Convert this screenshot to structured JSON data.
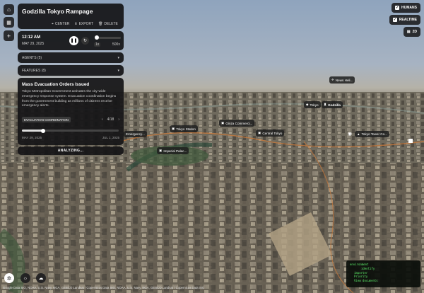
{
  "title": "Godzilla Tokyo Rampage",
  "toolbar": {
    "center_label": "CENTER",
    "export_label": "EXPORT",
    "delete_label": "DELETE"
  },
  "time": {
    "clock": "12:12 AM",
    "date": "MAY 29, 2025",
    "speed_min": "1x",
    "speed_max": "500x"
  },
  "sections": {
    "agents_label": "AGENTS (5)",
    "features_label": "FEATURES (8)"
  },
  "event": {
    "title": "Mass Evacuation Orders Issued",
    "body": "Tokyo Metropolitan Government activates the city-wide emergency response system. Evacuation coordination begins from the government building as millions of citizens receive emergency alerts.",
    "tag": "EVACUATION COORDINATION",
    "counter": "4/18",
    "start_date": "MAY 29, 2025",
    "end_date": "JUL 1, 2025",
    "progress": 0.22
  },
  "analyzing_label": "ANALYZING...",
  "top_right": {
    "humans_label": "HUMANS",
    "realtime_label": "REALTIME",
    "mode_label": "2D"
  },
  "map_labels": {
    "news_heli": "News Heli...",
    "tokyo": "Tokyo",
    "godzilla": "Godzilla",
    "emergency": "Emergency...",
    "tokyo_station": "Tokyo Station",
    "ginza": "Ginza Commerci...",
    "central_tokyo": "Central Tokyo",
    "tokyo_tower": "Tokyo Tower Co...",
    "imperial_palace": "Imperial Palac..."
  },
  "terminal": {
    "lines": [
      "environment",
      "identify",
      "importer",
      "Priority",
      "View documents"
    ]
  },
  "attribution": "Google Data SIO, NOAA, U.S. Navy, NGA, GEBCO Landsat / Copernicus Data SIO, NOAA, U.S. Navy, NGA, GEBCO Landsat / Copernicus Data SIO"
}
